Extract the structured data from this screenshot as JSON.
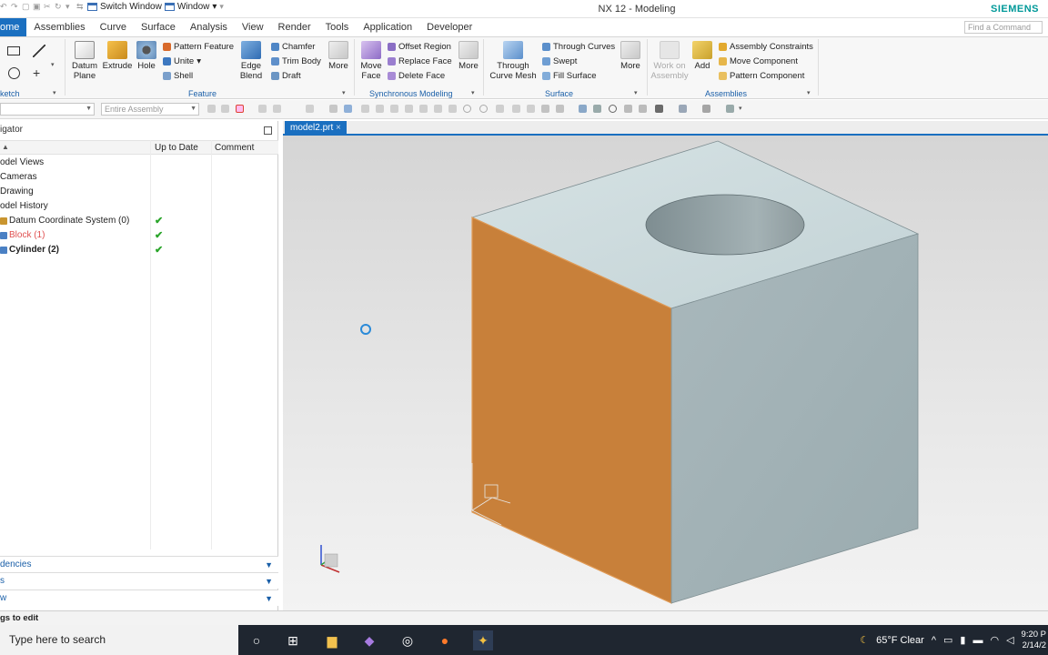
{
  "titlebar": {
    "switch_window": "Switch Window",
    "window_menu": "Window",
    "app_title": "NX 12 - Modeling",
    "brand": "SIEMENS"
  },
  "menu": {
    "tabs": [
      "ome",
      "Assemblies",
      "Curve",
      "Surface",
      "Analysis",
      "View",
      "Render",
      "Tools",
      "Application",
      "Developer"
    ],
    "search_placeholder": "Find a Command"
  },
  "ribbon": {
    "sketch_group": "ketch",
    "feature": {
      "datum_plane": "Datum\nPlane",
      "extrude": "Extrude",
      "hole": "Hole",
      "pattern_feature": "Pattern Feature",
      "unite": "Unite",
      "shell": "Shell",
      "edge_blend": "Edge\nBlend",
      "chamfer": "Chamfer",
      "trim_body": "Trim Body",
      "draft": "Draft",
      "more": "More",
      "group": "Feature"
    },
    "sync": {
      "move_face": "Move\nFace",
      "offset_region": "Offset Region",
      "replace_face": "Replace Face",
      "delete_face": "Delete Face",
      "more": "More",
      "group": "Synchronous Modeling"
    },
    "surface": {
      "through_curve_mesh": "Through\nCurve Mesh",
      "through_curves": "Through Curves",
      "swept": "Swept",
      "fill_surface": "Fill Surface",
      "more": "More",
      "group": "Surface"
    },
    "assemblies": {
      "work_on_assembly": "Work on\nAssembly",
      "add": "Add",
      "assembly_constraints": "Assembly Constraints",
      "move_component": "Move Component",
      "pattern_component": "Pattern Component",
      "group": "Assemblies"
    }
  },
  "toolbar2": {
    "filter_combo": "",
    "scope_combo": "Entire Assembly"
  },
  "navigator": {
    "title": "igator",
    "columns": [
      "Up to Date",
      "Comment"
    ],
    "rows": [
      {
        "label": "odel Views",
        "up_to_date": ""
      },
      {
        "label": "Cameras",
        "up_to_date": ""
      },
      {
        "label": "Drawing",
        "up_to_date": ""
      },
      {
        "label": "odel History",
        "up_to_date": ""
      },
      {
        "label": "Datum Coordinate System (0)",
        "up_to_date": "✔"
      },
      {
        "label": "Block (1)",
        "up_to_date": "✔"
      },
      {
        "label": "Cylinder (2)",
        "up_to_date": "✔"
      }
    ],
    "panels": [
      "dencies",
      "s",
      "w"
    ]
  },
  "viewport": {
    "tab": "model2.prt"
  },
  "status": {
    "text": "gs to edit"
  },
  "taskbar": {
    "search": "Type here to search",
    "weather": "65°F  Clear",
    "time": "9:20 P",
    "date": "2/14/2"
  },
  "colors": {
    "accent": "#1a6fc0",
    "selected_face": "#c8803a",
    "body_face": "#b9cbd0",
    "check": "#2aa52a"
  }
}
